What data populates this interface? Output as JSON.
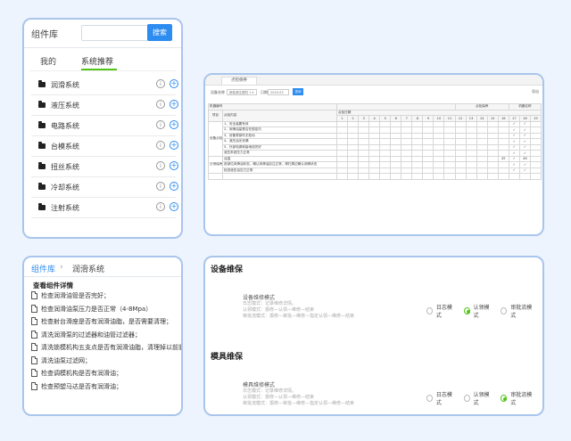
{
  "library_panel": {
    "title": "组件库",
    "search_placeholder": "",
    "search_button": "搜索",
    "tabs": [
      "我的",
      "系统推荐"
    ],
    "active_tab": "系统推荐",
    "items": [
      "润滑系统",
      "液压系统",
      "电路系统",
      "台模系统",
      "扭丝系统",
      "冷却系统",
      "注射系统"
    ]
  },
  "table_panel": {
    "tab_label": "点检保养",
    "filter_label_1": "设备名称",
    "filter_select_1": "新能源注塑机 1 ▾",
    "filter_label_2": "日期",
    "filter_date": "2020-03",
    "query_button": "查询",
    "export_label": "导出",
    "head_row1": [
      "机器编号",
      "",
      "",
      "",
      "",
      "",
      "",
      "",
      "",
      "",
      "",
      "",
      "",
      "",
      "",
      "",
      "",
      "",
      "",
      "",
      "点检保养",
      "",
      "",
      "",
      "",
      "",
      "",
      "",
      "",
      "",
      "",
      "",
      "",
      "",
      "机器名称"
    ],
    "group_label": "点检日期",
    "category_header": "项目",
    "content_header": "点检内容",
    "days": [
      "1",
      "2",
      "3",
      "4",
      "5",
      "6",
      "7",
      "8",
      "9",
      "10",
      "11",
      "12",
      "13",
      "14",
      "15",
      "16",
      "17",
      "18",
      "19"
    ],
    "rows": [
      {
        "cat": "设备点检",
        "text": "1、安全装置有效",
        "marks": {
          "16": "✓",
          "17": "✓"
        }
      },
      {
        "cat": "",
        "text": "2、润滑油量是否在规定内",
        "marks": {
          "16": "✓",
          "17": "✓"
        }
      },
      {
        "cat": "",
        "text": "3、设备零部件无松动",
        "marks": {
          "16": "✓",
          "17": "✓"
        }
      },
      {
        "cat": "",
        "text": "4、液压油无泄漏",
        "marks": {
          "16": "✓",
          "17": "✓"
        }
      },
      {
        "cat": "",
        "text": "5、外部电源和接地线完好",
        "marks": {
          "16": "✓",
          "17": "✓"
        }
      },
      {
        "cat": "",
        "text": "液压系统压力正常",
        "marks": {
          "16": "✓",
          "17": "✓"
        }
      },
      {
        "cat": "日常保养",
        "text": "油温",
        "marks": {
          "15": "45",
          "16": "✓",
          "17": "46"
        }
      },
      {
        "cat": "",
        "text": "各部位润滑油状态，确认润滑油加注正常，清扫周边确认润滑状态",
        "marks": {
          "16": "✓",
          "17": "✓"
        }
      },
      {
        "cat": "",
        "text": "检查液压油压力正常",
        "marks": {
          "16": "✓",
          "17": "✓"
        }
      }
    ]
  },
  "detail_panel": {
    "breadcrumb_root": "组件库",
    "breadcrumb_sep": "›",
    "breadcrumb_current": "润滑系统",
    "heading": "查看组件详情",
    "items": [
      "检查润滑油管是否完好；",
      "检查润滑油泵压力是否正常（4-8Mpa）",
      "检查射台滑座是否有润滑油脂，是否需要清理；",
      "清洗润滑泵的过滤器和油管过滤器；",
      "清洗锁模机构五支点是否有润滑油脂，清理掉以前旧",
      "清洗油泵过滤网；",
      "检查调模机构是否有润滑油；",
      "检查预塑马达是否有润滑油；"
    ]
  },
  "modes_panel": {
    "sections": [
      {
        "title": "设备维保",
        "mode_title": "设备维修模式",
        "desc": [
          "日志模式：记录维修详情。",
          "认领模式：报修—认领—维修—结束",
          "审批流模式：报修—审批—维修—指定认领—维修—结束"
        ],
        "options": [
          "日志模式",
          "认领模式",
          "审批流模式"
        ],
        "selected": 1
      },
      {
        "title": "模具维保",
        "mode_title": "模具维修模式",
        "desc": [
          "日志模式：记录维修详情。",
          "认领模式：报修—认领—维修—结束",
          "审批流模式：报修—审批—维修—指定认领—维修—结束"
        ],
        "options": [
          "日志模式",
          "认领模式",
          "审批流模式"
        ],
        "selected": 2
      }
    ]
  }
}
